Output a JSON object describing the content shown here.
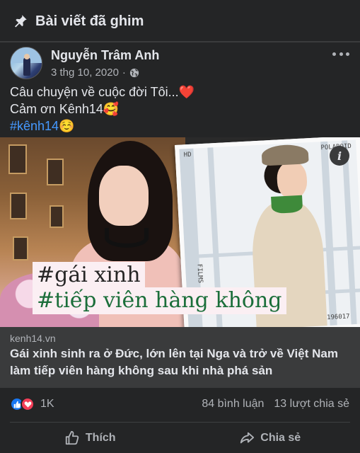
{
  "pinned": {
    "title": "Bài viết đã ghim",
    "icon": "pin-icon"
  },
  "post": {
    "author_name": "Nguyễn Trâm Anh",
    "date": "3 thg 10, 2020",
    "separator": "·",
    "privacy_icon": "globe-icon",
    "caption_lines": [
      "Câu chuyện về cuộc đời Tôi...❤️",
      "Cảm ơn Kênh14🥰",
      "#kênh14☺️"
    ],
    "image_overlay_lines": [
      "#gái xinh",
      "#tiếp viên hàng không"
    ],
    "photo_labels": [
      "HD",
      "POLAROID",
      "FILMS",
      "196017"
    ]
  },
  "link": {
    "domain": "kenh14.vn",
    "title": "Gái xinh sinh ra ở Đức, lớn lên tại Nga và trở về Việt Nam làm tiếp viên hàng không sau khi nhà phá sản"
  },
  "engagement": {
    "reactions_count": "1K",
    "comments": "84 bình luận",
    "shares": "13 lượt chia sẻ",
    "reaction_icons": [
      "like-reaction-icon",
      "love-reaction-icon"
    ]
  },
  "actions": {
    "like_label": "Thích",
    "share_label": "Chia sẻ"
  },
  "colors": {
    "background": "#18191a",
    "card": "#242526",
    "link_bg": "#3a3b3c",
    "hashtag": "#4599ff",
    "like_blue": "#1877f2",
    "love_red": "#f33e58"
  }
}
